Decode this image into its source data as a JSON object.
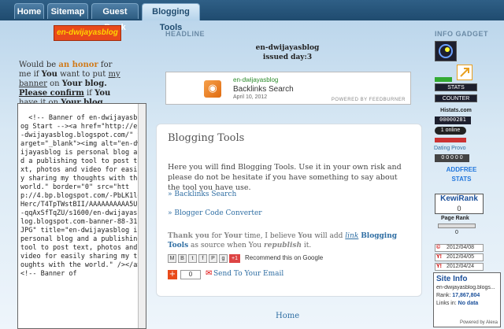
{
  "nav": {
    "tabs": [
      {
        "label": "Home",
        "active": false
      },
      {
        "label": "Sitemap",
        "active": false
      },
      {
        "label": "Guest Book",
        "active": false
      },
      {
        "label": "Blogging Tools",
        "active": true
      }
    ]
  },
  "sidebar_left": {
    "logo_text": "en-dwijayasblog",
    "intro_1": "Would be ",
    "intro_honor": "an honor",
    "intro_2": " for me if ",
    "intro_you": "You",
    "intro_3": " want to put ",
    "intro_my_banner": "my banner",
    "intro_4": " on ",
    "intro_your_blog": "Your blog.",
    "confirm": "Please confirm",
    "confirm_2": " if ",
    "confirm_you": "You",
    "confirm_3": " have it on ",
    "confirm_your_blog": "Your blog.",
    "banner_code": "<!-- Banner of en-dwijayasblog Start --><a href=\"http://en-dwijayasblog.blogspot.com/\" target=\"_blank\"><img alt=\"en-dwijayasblog is personal blog and a publishing tool to post text, photos and video for easily sharing my thoughts with the world.\" border=\"0\" src=\"http://4.bp.blogspot.com/-PbLK1ldHerc/T4TpTWstBII/AAAAAAAAAA5U/-qqAxSfTqZU/s1600/en-dwijayasblog.blogspot.com-banner-88-31.JPG\" title=\"en-dwijayasblog is personal blog and a publishing tool to post text, photos and video for easily sharing my thoughts with the world.\" /></a><!-- Banner of"
  },
  "center": {
    "headline_label": "HEADLINE",
    "feed_title_1": "en-dwijayasblog",
    "feed_title_2": "issued day:3",
    "feed": {
      "source": "en-dwijayasblog",
      "title": "Backlinks Search",
      "date": "April 10, 2012",
      "powered": "POWERED BY FEEDBURNER"
    },
    "post": {
      "title": "Blogging Tools",
      "body": "Here you will find Blogging Tools. Use it in your own risk and please do not be hesitate if you have something to say about the tool you have use.",
      "link1": "» Backlinks Search",
      "link2": "» Blogger Code Converter",
      "thanks_1": "Thank you",
      "thanks_2": " for ",
      "thanks_your": "Your",
      "thanks_3": " time, I believe ",
      "thanks_you": "You",
      "thanks_4": " will add ",
      "thanks_link": "link",
      "thanks_5": " ",
      "thanks_bt": "Blogging Tools",
      "thanks_6": " as source when You ",
      "thanks_rep": "republish",
      "thanks_7": " it.",
      "recommend": "Recommend this on Google",
      "plus_count": "+1",
      "share_count": "0",
      "send": "Send To Your Email"
    },
    "home_link": "Home"
  },
  "sidebar_right": {
    "label": "INFO GADGET",
    "stats_label": "STATS",
    "counter_label": "COUNTER",
    "histats": "Histats.com",
    "histats_count": "00000281",
    "online": "1 online",
    "dating_provo": "Dating Provo",
    "addfree": "ADDFREE STATS",
    "kewi_1": "KewiRank",
    "kewi_2": "0",
    "pagerank": "Page Rank",
    "pagerank_value": "0",
    "date1": "2012/04/08",
    "date2": "2012/04/05",
    "date3": "2012/04/24",
    "site_info": "Site Info",
    "site_url": "en-dwijayasblog.blogs...",
    "rank_label": "Rank:",
    "rank_value": "17,867,804",
    "links_label": "Links in:",
    "links_value": "No data",
    "powered": "Powered by Alexa"
  }
}
